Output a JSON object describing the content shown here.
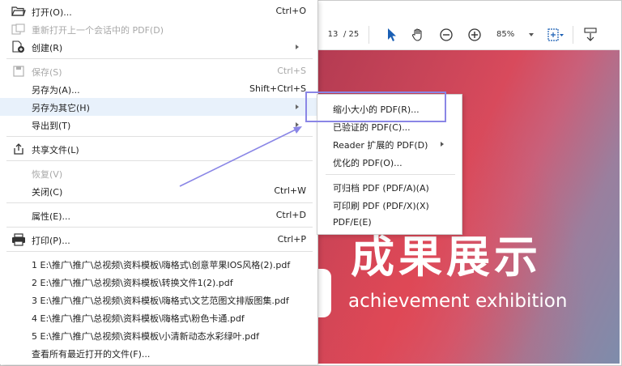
{
  "toolbar": {
    "page_current": "13",
    "page_total": "/ 25",
    "zoom": "85%",
    "icons": [
      "select-cursor-icon",
      "hand-icon",
      "zoom-out-icon",
      "zoom-in-icon",
      "fit-page-icon",
      "scroll-icon"
    ]
  },
  "document": {
    "title_cn": "成果展示",
    "title_en": "achievement exhibition"
  },
  "menu": {
    "open": {
      "label": "打开(O)...",
      "shortcut": "Ctrl+O"
    },
    "reopen": {
      "label": "重新打开上一个会话中的 PDF(D)"
    },
    "create": {
      "label": "创建(R)"
    },
    "save": {
      "label": "保存(S)",
      "shortcut": "Ctrl+S"
    },
    "save_as": {
      "label": "另存为(A)...",
      "shortcut": "Shift+Ctrl+S"
    },
    "save_as_other": {
      "label": "另存为其它(H)"
    },
    "export_to": {
      "label": "导出到(T)"
    },
    "share": {
      "label": "共享文件(L)"
    },
    "revert": {
      "label": "恢复(V)"
    },
    "close": {
      "label": "关闭(C)",
      "shortcut": "Ctrl+W"
    },
    "properties": {
      "label": "属性(E)...",
      "shortcut": "Ctrl+D"
    },
    "print": {
      "label": "打印(P)...",
      "shortcut": "Ctrl+P"
    },
    "recent": [
      "1 E:\\推广\\推广\\总视频\\资料模板\\嗨格式\\创意苹果IOS风格(2).pdf",
      "2 E:\\推广\\推广\\总视频\\资料模板\\转换文件1(2).pdf",
      "3 E:\\推广\\推广\\总视频\\资料模板\\嗨格式\\文艺范图文排版图集.pdf",
      "4 E:\\推广\\推广\\总视频\\资料模板\\嗨格式\\粉色卡通.pdf",
      "5 E:\\推广\\推广\\总视频\\资料模板\\小清新动态水彩绿叶.pdf"
    ],
    "view_all_recent": {
      "label": "查看所有最近打开的文件(F)..."
    }
  },
  "submenu": {
    "items": [
      {
        "label": "缩小大小的 PDF(R)..."
      },
      {
        "label": "已验证的 PDF(C)..."
      },
      {
        "label": "Reader 扩展的 PDF(D)"
      },
      {
        "label": "优化的 PDF(O)..."
      },
      {
        "label": "可归档 PDF (PDF/A)(A)"
      },
      {
        "label": "可印刷 PDF (PDF/X)(X)"
      },
      {
        "label": "PDF/E(E)"
      }
    ]
  },
  "colors": {
    "annotation": "#8a86e6",
    "highlight": "#e8f1fb",
    "toolbar_icon": "#1a5fb4"
  }
}
